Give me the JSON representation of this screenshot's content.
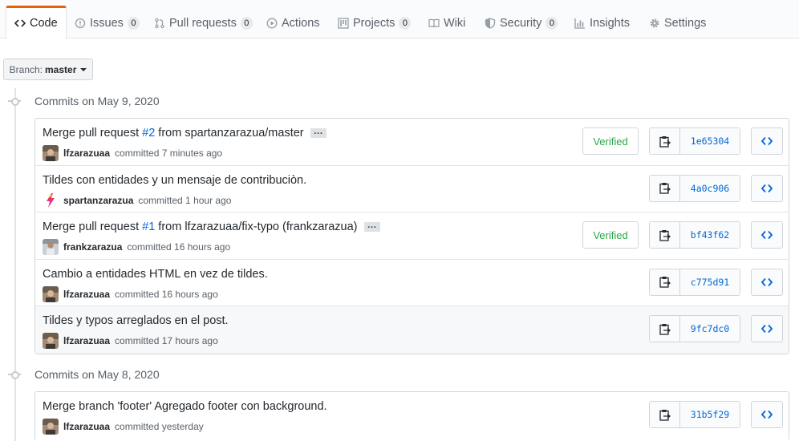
{
  "tabs": [
    {
      "id": "code",
      "label": "Code",
      "icon": "code-icon",
      "counter": null,
      "selected": true
    },
    {
      "id": "issues",
      "label": "Issues",
      "icon": "issue-opened-icon",
      "counter": "0"
    },
    {
      "id": "pulls",
      "label": "Pull requests",
      "icon": "git-pull-request-icon",
      "counter": "0"
    },
    {
      "id": "actions",
      "label": "Actions",
      "icon": "play-icon",
      "counter": null
    },
    {
      "id": "projects",
      "label": "Projects",
      "icon": "project-icon",
      "counter": "0"
    },
    {
      "id": "wiki",
      "label": "Wiki",
      "icon": "book-icon",
      "counter": null
    },
    {
      "id": "security",
      "label": "Security",
      "icon": "shield-icon",
      "counter": "0"
    },
    {
      "id": "insights",
      "label": "Insights",
      "icon": "graph-icon",
      "counter": null
    },
    {
      "id": "settings",
      "label": "Settings",
      "icon": "gear-icon",
      "counter": null
    }
  ],
  "branch": {
    "prefix": "Branch:",
    "name": "master"
  },
  "days": [
    {
      "header": "Commits on May 9, 2020",
      "commits": [
        {
          "title_pre": "Merge pull request ",
          "issue": "#2",
          "title_post": " from spartanzarazua/master",
          "has_ellipsis": true,
          "author": "lfzarazuaa",
          "time": "committed 7 minutes ago",
          "verified": "Verified",
          "sha": "1e65304",
          "avatar": "photo"
        },
        {
          "title_pre": "Tildes con entidades y un mensaje de contribuciòn.",
          "issue": "",
          "title_post": "",
          "has_ellipsis": false,
          "author": "spartanzarazua",
          "time": "committed 1 hour ago",
          "verified": "",
          "sha": "4a0c906",
          "avatar": "bolt"
        },
        {
          "title_pre": "Merge pull request ",
          "issue": "#1",
          "title_post": " from lfzarazuaa/fix-typo (frankzarazua)",
          "has_ellipsis": true,
          "author": "frankzarazua",
          "time": "committed 16 hours ago",
          "verified": "Verified",
          "sha": "bf43f62",
          "avatar": "photo2"
        },
        {
          "title_pre": "Cambio a entidades HTML en vez de tildes.",
          "issue": "",
          "title_post": "",
          "has_ellipsis": false,
          "author": "lfzarazuaa",
          "time": "committed 16 hours ago",
          "verified": "",
          "sha": "c775d91",
          "avatar": "photo"
        },
        {
          "title_pre": "Tildes y typos arreglados en el post.",
          "issue": "",
          "title_post": "",
          "has_ellipsis": false,
          "author": "lfzarazuaa",
          "time": "committed 17 hours ago",
          "verified": "",
          "sha": "9fc7dc0",
          "avatar": "photo",
          "highlighted": true
        }
      ]
    },
    {
      "header": "Commits on May 8, 2020",
      "commits": [
        {
          "title_pre": "Merge branch 'footer' Agregado footer con background.",
          "issue": "",
          "title_post": "",
          "has_ellipsis": false,
          "author": "lfzarazuaa",
          "time": "committed yesterday",
          "verified": "",
          "sha": "31b5f29",
          "avatar": "photo"
        }
      ]
    }
  ],
  "ellipsis_label": "…"
}
